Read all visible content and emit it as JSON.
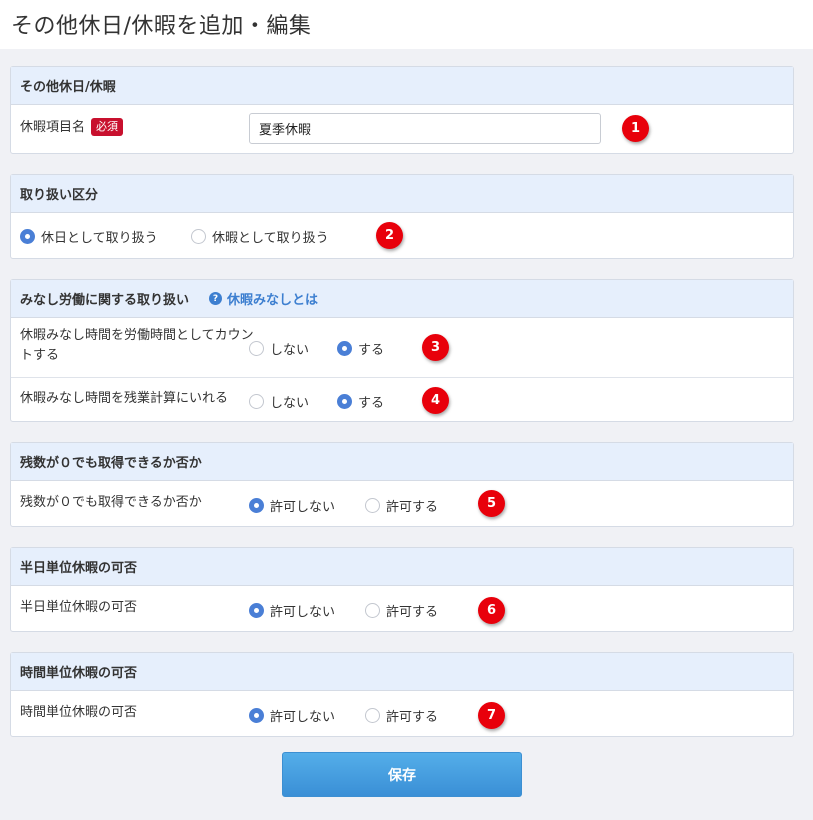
{
  "page": {
    "title": "その他休日/休暇を追加・編集"
  },
  "sections": {
    "name": {
      "header": "その他休日/休暇",
      "label": "休暇項目名",
      "required_badge": "必須",
      "value": "夏季休暇",
      "marker": "1"
    },
    "type": {
      "header": "取り扱い区分",
      "option_holiday": "休日として取り扱う",
      "option_leave": "休暇として取り扱う",
      "selected": "holiday",
      "marker": "2"
    },
    "deemed": {
      "header": "みなし労働に関する取り扱い",
      "help_link": "休暇みなしとは",
      "row1": {
        "label": "休暇みなし時間を労働時間としてカウントする",
        "option_no": "しない",
        "option_yes": "する",
        "selected": "yes",
        "marker": "3"
      },
      "row2": {
        "label": "休暇みなし時間を残業計算にいれる",
        "option_no": "しない",
        "option_yes": "する",
        "selected": "yes",
        "marker": "4"
      }
    },
    "zero_balance": {
      "header": "残数が０でも取得できるか否か",
      "label": "残数が０でも取得できるか否か",
      "option_deny": "許可しない",
      "option_allow": "許可する",
      "selected": "deny",
      "marker": "5"
    },
    "half_day": {
      "header": "半日単位休暇の可否",
      "label": "半日単位休暇の可否",
      "option_deny": "許可しない",
      "option_allow": "許可する",
      "selected": "deny",
      "marker": "6"
    },
    "hourly": {
      "header": "時間単位休暇の可否",
      "label": "時間単位休暇の可否",
      "option_deny": "許可しない",
      "option_allow": "許可する",
      "selected": "deny",
      "marker": "7"
    }
  },
  "actions": {
    "save_label": "保存"
  },
  "colors": {
    "accent": "#4a7fd6",
    "section_header_bg": "#e6effc",
    "required_badge": "#c8102e",
    "marker": "#e8000b",
    "save_button": "#3a8fd6"
  }
}
